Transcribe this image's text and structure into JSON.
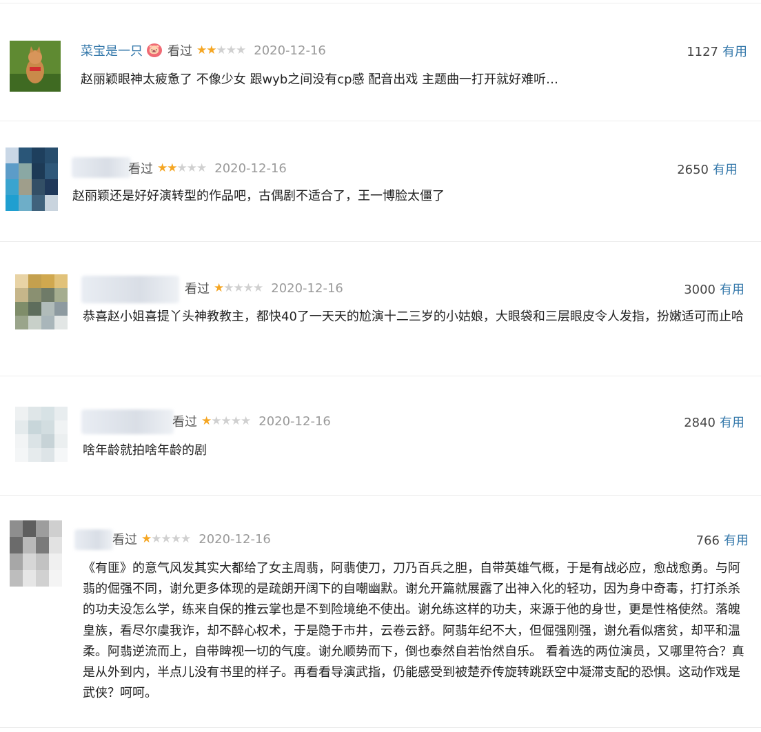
{
  "comments": [
    {
      "username": "菜宝是一只",
      "badge": "🐷",
      "seen_label": "看过",
      "rating": 2,
      "max_rating": 5,
      "date": "2020-12-16",
      "votes": "1127",
      "useful_label": "有用",
      "text": "赵丽颖眼神太疲惫了 不像少女 跟wyb之间没有cp感 配音出戏 主题曲一打开就好难听…"
    },
    {
      "username": "",
      "seen_label": "看过",
      "rating": 2,
      "max_rating": 5,
      "date": "2020-12-16",
      "votes": "2650",
      "useful_label": "有用",
      "text": "赵丽颖还是好好演转型的作品吧，古偶剧不适合了，王一博脸太僵了"
    },
    {
      "username": "",
      "seen_label": "看过",
      "rating": 1,
      "max_rating": 5,
      "date": "2020-12-16",
      "votes": "3000",
      "useful_label": "有用",
      "text": "恭喜赵小姐喜提丫头神教教主，都快40了一天天的尬演十二三岁的小姑娘，大眼袋和三层眼皮令人发指，扮嫩适可而止哈"
    },
    {
      "username": "",
      "seen_label": "看过",
      "rating": 1,
      "max_rating": 5,
      "date": "2020-12-16",
      "votes": "2840",
      "useful_label": "有用",
      "text": "啥年龄就拍啥年龄的剧"
    },
    {
      "username": "",
      "seen_label": "看过",
      "rating": 1,
      "max_rating": 5,
      "date": "2020-12-16",
      "votes": "766",
      "useful_label": "有用",
      "text": "《有匪》的意气风发其实大都给了女主周翡，阿翡使刀，刀乃百兵之胆，自带英雄气概，于是有战必应，愈战愈勇。与阿翡的倔强不同，谢允更多体现的是疏朗开阔下的自嘲幽默。谢允开篇就展露了出神入化的轻功，因为身中奇毒，打打杀杀的功夫没怎么学，练来自保的推云掌也是不到险境绝不使出。谢允练这样的功夫，来源于他的身世，更是性格使然。落魄皇族，看尽尔虞我诈，却不醉心权术，于是隐于市井，云卷云舒。阿翡年纪不大，但倔强刚强，谢允看似痞贫，却平和温柔。阿翡逆流而上，自带睥视一切的气度。谢允顺势而下，倒也泰然自若怡然自乐。 看着选的两位演员，又哪里符合？真是从外到内，半点儿没有书里的样子。再看看导演武指，仍能感受到被楚乔传旋转跳跃空中凝滞支配的恐惧。这动作戏是武侠？呵呵。"
    }
  ]
}
